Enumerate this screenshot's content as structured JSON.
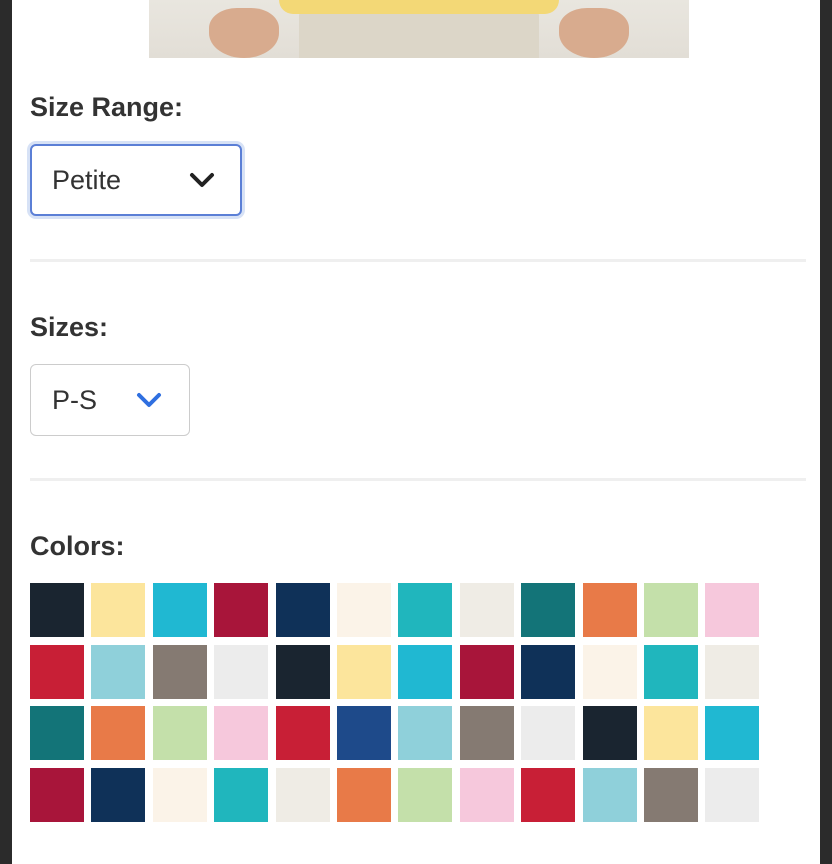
{
  "size_range": {
    "label": "Size Range:",
    "selected": "Petite"
  },
  "sizes": {
    "label": "Sizes:",
    "selected": "P-S"
  },
  "colors": {
    "label": "Colors:",
    "swatches": [
      "#1a2530",
      "#fce59c",
      "#20b8d2",
      "#a8153a",
      "#0f3158",
      "#fbf3e8",
      "#20b6bd",
      "#efece5",
      "#137478",
      "#e87a48",
      "#c4e0aa",
      "#f6c8dc",
      "#c81f36",
      "#8fd0da",
      "#857a72",
      "#ececec",
      "#1a2530",
      "#fce59c",
      "#20b8d2",
      "#a8153a",
      "#0f3158",
      "#fbf3e8",
      "#20b6bd",
      "#efece5",
      "#137478",
      "#e87a48",
      "#c4e0aa",
      "#f6c8dc",
      "#c81f36",
      "#1e4a8a",
      "#8fd0da",
      "#857a72",
      "#ececec",
      "#1a2530",
      "#fce59c",
      "#20b8d2",
      "#a8153a",
      "#0f3158",
      "#fbf3e8",
      "#20b6bd",
      "#efece5",
      "#e87a48",
      "#c4e0aa",
      "#f6c8dc",
      "#c81f36",
      "#8fd0da",
      "#857a72",
      "#ececec"
    ]
  },
  "icons": {
    "size_range_chevron": "chevron-down-icon",
    "sizes_chevron": "chevron-down-icon"
  },
  "accent_color": "#2f6fe0"
}
